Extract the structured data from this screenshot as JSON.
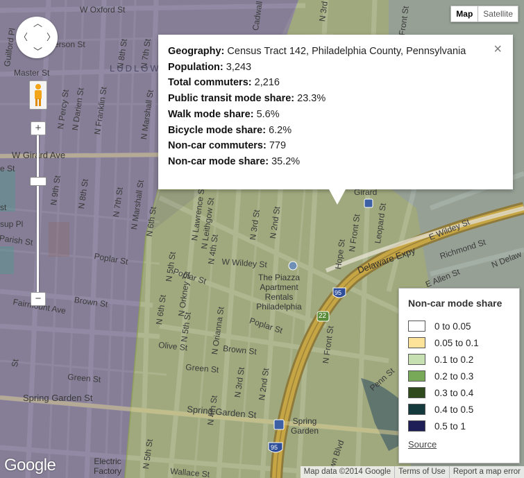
{
  "map_type": {
    "map_label": "Map",
    "satellite_label": "Satellite"
  },
  "info_window": {
    "rows": [
      {
        "key": "Geography:",
        "value": "Census Tract 142, Philadelphia County, Pennsylvania"
      },
      {
        "key": "Population:",
        "value": "3,243"
      },
      {
        "key": "Total commuters:",
        "value": "2,216"
      },
      {
        "key": "Public transit mode share:",
        "value": "23.3%"
      },
      {
        "key": "Walk mode share:",
        "value": "5.6%"
      },
      {
        "key": "Bicycle mode share:",
        "value": "6.2%"
      },
      {
        "key": "Non-car commuters:",
        "value": "779"
      },
      {
        "key": "Non-car mode share:",
        "value": "35.2%"
      }
    ],
    "close_glyph": "×"
  },
  "legend": {
    "title": "Non-car mode share",
    "items": [
      {
        "label": "0 to 0.05",
        "color": "#ffffff"
      },
      {
        "label": "0.05 to 0.1",
        "color": "#fde39a"
      },
      {
        "label": "0.1 to 0.2",
        "color": "#c7e0b1"
      },
      {
        "label": "0.2 to 0.3",
        "color": "#78a958"
      },
      {
        "label": "0.3 to 0.4",
        "color": "#2f4a1c"
      },
      {
        "label": "0.4 to 0.5",
        "color": "#153a3d"
      },
      {
        "label": "0.5 to 1",
        "color": "#1f1f57"
      }
    ],
    "source_link": "Source"
  },
  "controls": {
    "zoom_in": "+",
    "zoom_out": "−"
  },
  "branding": {
    "logo_text": "Google"
  },
  "footer": {
    "map_data": "Map data ©2014 Google",
    "terms": "Terms of Use",
    "report": "Report a map error"
  },
  "map_labels": {
    "w_oxford_st": "W Oxford St",
    "cadwallader": "Cadwall",
    "n_7th_st_top": "N 7th St",
    "n_8th_st_top": "N 8th St",
    "n_3rd_st_top": "N 3rd St",
    "front_st_top": "Front St",
    "guilford_pl": "Guilford Pl",
    "jefferson_st": "erson St",
    "master_st": "Master St",
    "ludlow": "LUDLOW",
    "n_percy_st": "N Percy St",
    "n_darien_st": "N Darien St",
    "n_franklin_st": "N Franklin St",
    "n_marshall_st_top": "N Marshall St",
    "w_girard_ave": "W Girard Ave",
    "est": "e St",
    "n_9th_st": "N 9th St",
    "n_8th_st": "N 8th St",
    "n_7th_st": "N 7th St",
    "n_marshall_st": "N Marshall St",
    "n_6th_st": "N 6th St",
    "n_5th_st": "N 5th St",
    "n_lawrence_st": "N Lawrence St",
    "n_leithgow_st": "N Leithgow St",
    "n_4th_st": "N 4th St",
    "n_3rd_st": "N 3rd St",
    "n_2nd_st": "N 2nd St",
    "n_front_st": "N Front St",
    "leopard_st": "Leopard St",
    "hope_st": "Hope St",
    "e_wildey_st": "E Wildey St",
    "richmond_st": "Richmond St",
    "delaware_expy": "Delaware Expy",
    "n_delaware": "N Delaw",
    "e_allen_st": "E Allen St",
    "w_wildey_st": "W Wildey St",
    "poplar_st_left": "Poplar St",
    "poplar_st_mid": "Poplar St",
    "poplar_st_right": "Poplar St",
    "brown_st_left": "Brown St",
    "brown_st_mid": "Brown St",
    "fairmount_ave": "Fairmount Ave",
    "n_orianna_st": "N Orianna St",
    "n_orkney_st": "N Orkney St",
    "olive_st": "Olive St",
    "green_st_left": "Green St",
    "green_st_right": "Green St",
    "spring_garden_left": "Spring Garden St",
    "spring_garden_mid": "Spring Garden St",
    "spring_garden_poi": "Spring Garden",
    "wallace_st": "Wallace St",
    "electric_factory": "Electric Factory",
    "piazza": "The Piazza Apartment Rentals Philadelphia",
    "girard": "Girard",
    "penn_st": "Penn St",
    "n_front_st_low": "N Front St",
    "n_2nd_st_low": "N 2nd St",
    "n_3rd_st_low": "N 3rd St",
    "n_4th_st_low": "N 4th St",
    "n_5th_st_low": "N 5th St",
    "n_6th_st_low": "N 6th St",
    "n_5th_st_low2": "N 5th St",
    "st_frag_left": "st",
    "sup_pl": "sup Pl",
    "parish_st": "Parish St",
    "st_frag2": "St",
    "brown_frag": "wn Blvd",
    "shield_95_top": "95",
    "shield_95_low": "95",
    "shield_22": "22",
    "wn_ave": "wn Ave"
  }
}
